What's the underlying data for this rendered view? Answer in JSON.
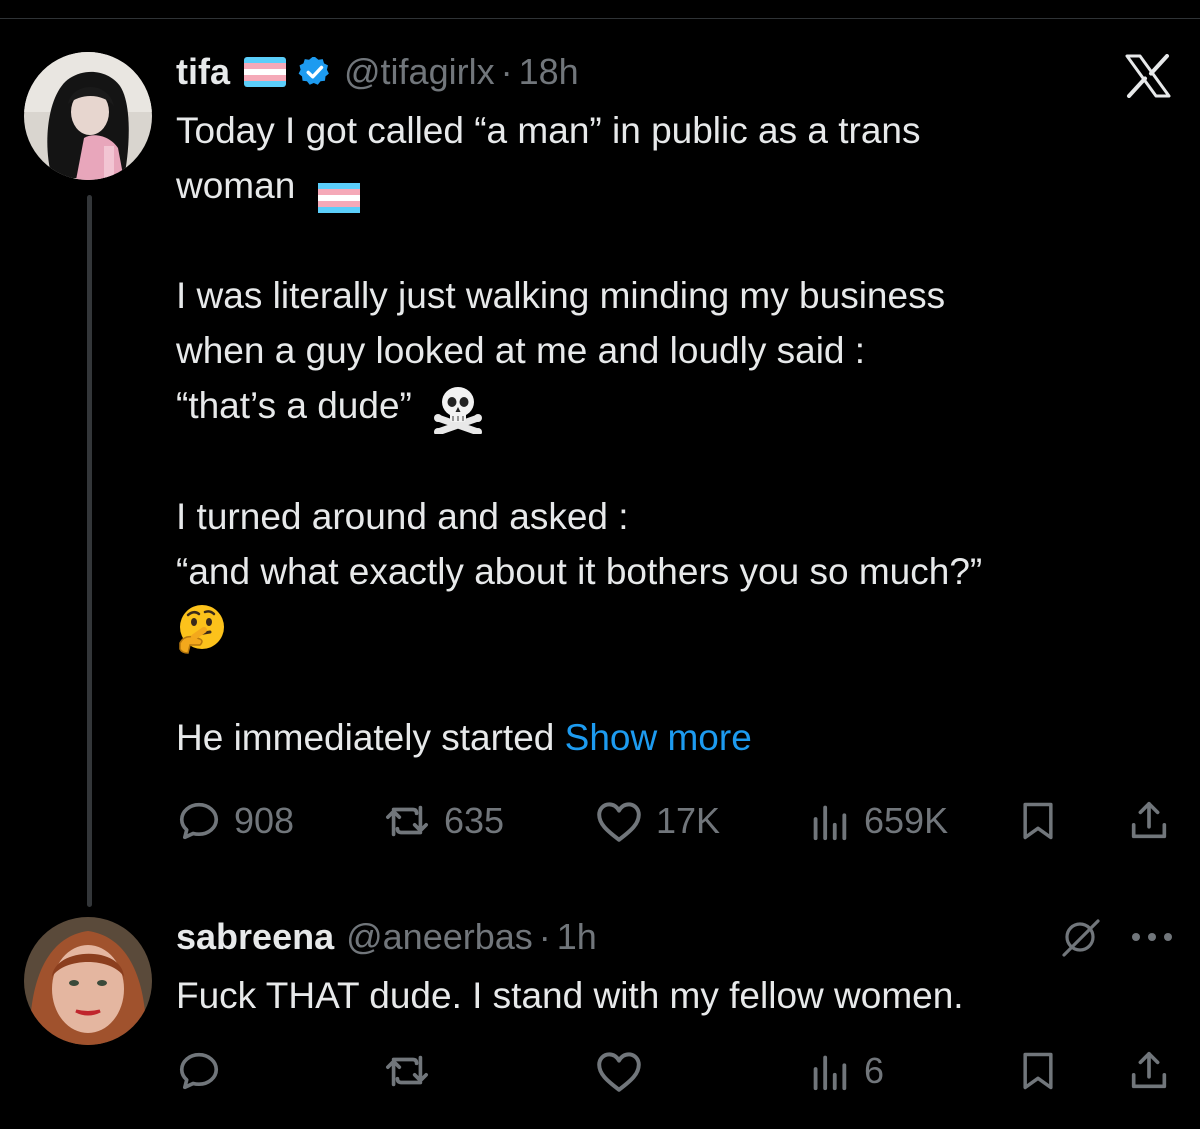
{
  "tweet": {
    "author_name": "tifa",
    "handle": "@tifagirlx",
    "separator": "·",
    "time": "18h",
    "line1": "Today I got called “a man” in public as a trans",
    "line2": "woman",
    "para2_line1": "I was literally just walking minding my business",
    "para2_line2": "when a guy looked at me and loudly said :",
    "para2_line3": "“that’s a dude”",
    "para3_line1": "I turned around and asked :",
    "para3_line2": "“and what exactly about it bothers you so much?”",
    "para4_text": "He immediately started",
    "show_more": "Show more",
    "stats": {
      "replies": "908",
      "reposts": "635",
      "likes": "17K",
      "views": "659K"
    }
  },
  "reply": {
    "author_name": "sabreena",
    "handle": "@aneerbas",
    "separator": "·",
    "time": "1h",
    "text": "Fuck THAT dude. I stand with my fellow women.",
    "stats": {
      "views": "6"
    }
  },
  "icons": {
    "flag": "transgender-flag-icon",
    "verified": "verified-badge-icon",
    "platform": "x-logo-icon",
    "reply": "comment-bubble-icon",
    "repost": "repost-icon",
    "like": "heart-icon",
    "views": "views-bar-chart-icon",
    "bookmark": "bookmark-icon",
    "share": "share-icon",
    "grok": "grok-icon",
    "more": "more-dots-icon",
    "skull": "skull-crossbones-emoji",
    "thinking": "thinking-face-emoji"
  },
  "colors": {
    "background": "#000000",
    "text": "#e7e9ea",
    "secondary": "#71767b",
    "link": "#1d9bf0",
    "verified": "#1d9bf0",
    "thread_line": "#333639"
  }
}
